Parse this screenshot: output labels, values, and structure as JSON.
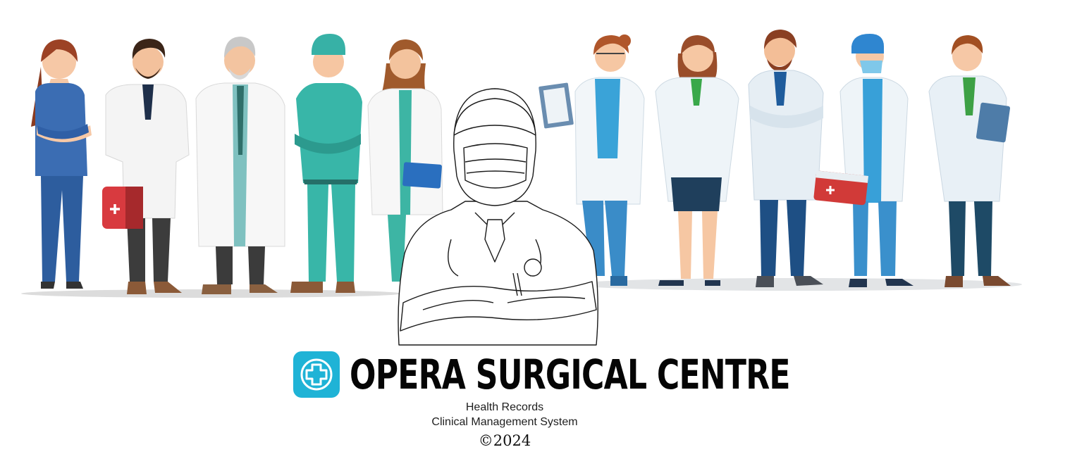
{
  "brand": {
    "title": "OPERA SURGICAL CENTRE",
    "subtitle_line1": "Health Records",
    "subtitle_line2": "Clinical Management System",
    "copyright": "©2024",
    "logo_icon": "medical-cross-icon",
    "accent": "#1fb3d6"
  },
  "illustration": {
    "characters": [
      "nurse-female-icon",
      "doctor-bearded-icon",
      "doctor-senior-icon",
      "nurse-male-scrubs-icon",
      "doctor-female-folder-icon",
      "doctor-line-art-icon",
      "doctor-female-clipboard-icon",
      "doctor-female-pen-icon",
      "doctor-bearded-arms-crossed-icon",
      "surgeon-masked-icon",
      "doctor-male-clipboard-icon"
    ]
  }
}
